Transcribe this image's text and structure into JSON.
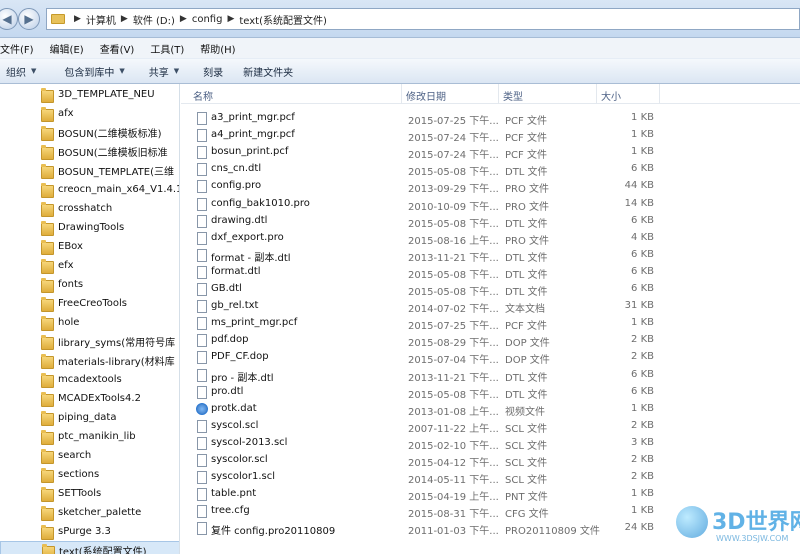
{
  "address": {
    "crumbs": [
      "计算机",
      "软件 (D:)",
      "config",
      "text(系统配置文件)"
    ]
  },
  "menu": [
    "文件(F)",
    "编辑(E)",
    "查看(V)",
    "工具(T)",
    "帮助(H)"
  ],
  "toolbar": {
    "organize": "组织",
    "include_library": "包含到库中",
    "share": "共享",
    "burn": "刻录",
    "new_folder": "新建文件夹"
  },
  "nav": [
    "3D_TEMPLATE_NEU",
    "afx",
    "BOSUN(二维模板标准)",
    "BOSUN(二维模板旧标准",
    "BOSUN_TEMPLATE(三维",
    "creocn_main_x64_V1.4.1",
    "crosshatch",
    "DrawingTools",
    "EBox",
    "efx",
    "fonts",
    "FreeCreoTools",
    "hole",
    "library_syms(常用符号库",
    "materials-library(材料库",
    "mcadextools",
    "MCADExTools4.2",
    "piping_data",
    "ptc_manikin_lib",
    "search",
    "sections",
    "SETTools",
    "sketcher_palette",
    "sPurge 3.3",
    "text(系统配置文件)"
  ],
  "nav_selected": 24,
  "columns": {
    "name": "名称",
    "date": "修改日期",
    "type": "类型",
    "size": "大小"
  },
  "files": [
    {
      "name": "a3_print_mgr.pcf",
      "date": "2015-07-25 下午...",
      "type": "PCF 文件",
      "size": "1 KB"
    },
    {
      "name": "a4_print_mgr.pcf",
      "date": "2015-07-24 下午...",
      "type": "PCF 文件",
      "size": "1 KB"
    },
    {
      "name": "bosun_print.pcf",
      "date": "2015-07-24 下午...",
      "type": "PCF 文件",
      "size": "1 KB"
    },
    {
      "name": "cns_cn.dtl",
      "date": "2015-05-08 下午...",
      "type": "DTL 文件",
      "size": "6 KB"
    },
    {
      "name": "config.pro",
      "date": "2013-09-29 下午...",
      "type": "PRO 文件",
      "size": "44 KB"
    },
    {
      "name": "config_bak1010.pro",
      "date": "2010-10-09 下午...",
      "type": "PRO 文件",
      "size": "14 KB"
    },
    {
      "name": "drawing.dtl",
      "date": "2015-05-08 下午...",
      "type": "DTL 文件",
      "size": "6 KB"
    },
    {
      "name": "dxf_export.pro",
      "date": "2015-08-16 上午...",
      "type": "PRO 文件",
      "size": "4 KB"
    },
    {
      "name": "format - 副本.dtl",
      "date": "2013-11-21 下午...",
      "type": "DTL 文件",
      "size": "6 KB"
    },
    {
      "name": "format.dtl",
      "date": "2015-05-08 下午...",
      "type": "DTL 文件",
      "size": "6 KB"
    },
    {
      "name": "GB.dtl",
      "date": "2015-05-08 下午...",
      "type": "DTL 文件",
      "size": "6 KB"
    },
    {
      "name": "gb_rel.txt",
      "date": "2014-07-02 下午...",
      "type": "文本文档",
      "size": "31 KB"
    },
    {
      "name": "ms_print_mgr.pcf",
      "date": "2015-07-25 下午...",
      "type": "PCF 文件",
      "size": "1 KB"
    },
    {
      "name": "pdf.dop",
      "date": "2015-08-29 下午...",
      "type": "DOP 文件",
      "size": "2 KB"
    },
    {
      "name": "PDF_CF.dop",
      "date": "2015-07-04 下午...",
      "type": "DOP 文件",
      "size": "2 KB"
    },
    {
      "name": "pro - 副本.dtl",
      "date": "2013-11-21 下午...",
      "type": "DTL 文件",
      "size": "6 KB"
    },
    {
      "name": "pro.dtl",
      "date": "2015-05-08 下午...",
      "type": "DTL 文件",
      "size": "6 KB"
    },
    {
      "name": "protk.dat",
      "date": "2013-01-08 上午...",
      "type": "视频文件",
      "size": "1 KB",
      "icon": "media"
    },
    {
      "name": "syscol.scl",
      "date": "2007-11-22 上午...",
      "type": "SCL 文件",
      "size": "2 KB"
    },
    {
      "name": "syscol-2013.scl",
      "date": "2015-02-10 下午...",
      "type": "SCL 文件",
      "size": "3 KB"
    },
    {
      "name": "syscolor.scl",
      "date": "2015-04-12 下午...",
      "type": "SCL 文件",
      "size": "2 KB"
    },
    {
      "name": "syscolor1.scl",
      "date": "2014-05-11 下午...",
      "type": "SCL 文件",
      "size": "2 KB"
    },
    {
      "name": "table.pnt",
      "date": "2015-04-19 上午...",
      "type": "PNT 文件",
      "size": "1 KB"
    },
    {
      "name": "tree.cfg",
      "date": "2015-08-31 下午...",
      "type": "CFG 文件",
      "size": "1 KB"
    },
    {
      "name": "复件 config.pro20110809",
      "date": "2011-01-03 下午...",
      "type": "PRO20110809 文件",
      "size": "24 KB"
    }
  ],
  "watermark": {
    "text": "3D世界网",
    "url": "WWW.3DSJW.COM"
  }
}
